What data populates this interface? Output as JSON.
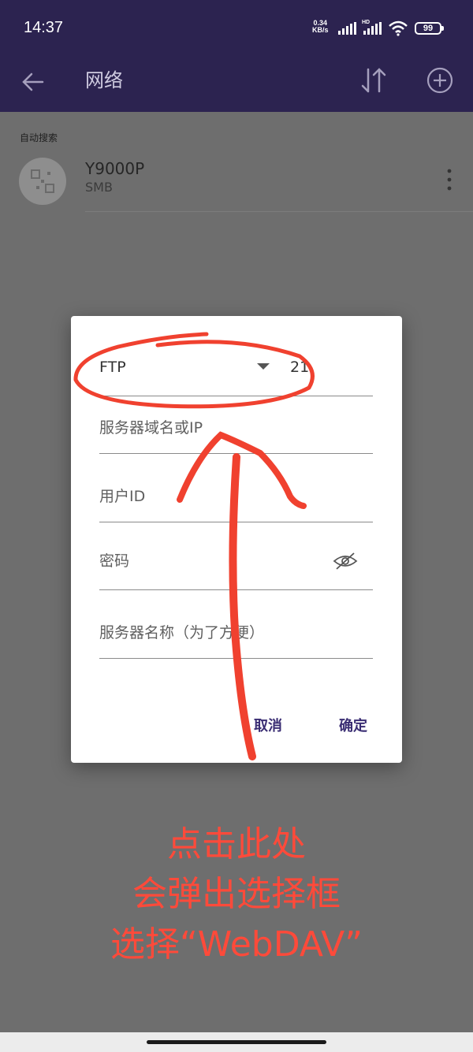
{
  "status_bar": {
    "time": "14:37",
    "net_speed_value": "0.34",
    "net_speed_unit": "KB/s",
    "hd_label": "HD",
    "battery": "99"
  },
  "app_bar": {
    "title": "网络",
    "back_icon": "arrow-left-icon",
    "sort_icon": "sort-arrows-icon",
    "add_icon": "add-circle-icon"
  },
  "list": {
    "section_header": "自动搜索",
    "devices": [
      {
        "name": "Y9000P",
        "type": "SMB",
        "icon": "qr-network-icon"
      }
    ]
  },
  "dialog": {
    "protocol": "FTP",
    "port": "21",
    "host_placeholder": "服务器域名或IP",
    "user_placeholder": "用户ID",
    "password_placeholder": "密码",
    "server_name_placeholder": "服务器名称（为了方便）",
    "cancel_label": "取消",
    "confirm_label": "确定"
  },
  "annotation": {
    "line1": "点击此处",
    "line2": "会弹出选择框",
    "line3": "选择“WebDAV”",
    "color": "#ff4a3a"
  },
  "colors": {
    "app_bar": "#2c2350",
    "scrim": "#6e6e6e",
    "accent": "#3a2d73"
  }
}
